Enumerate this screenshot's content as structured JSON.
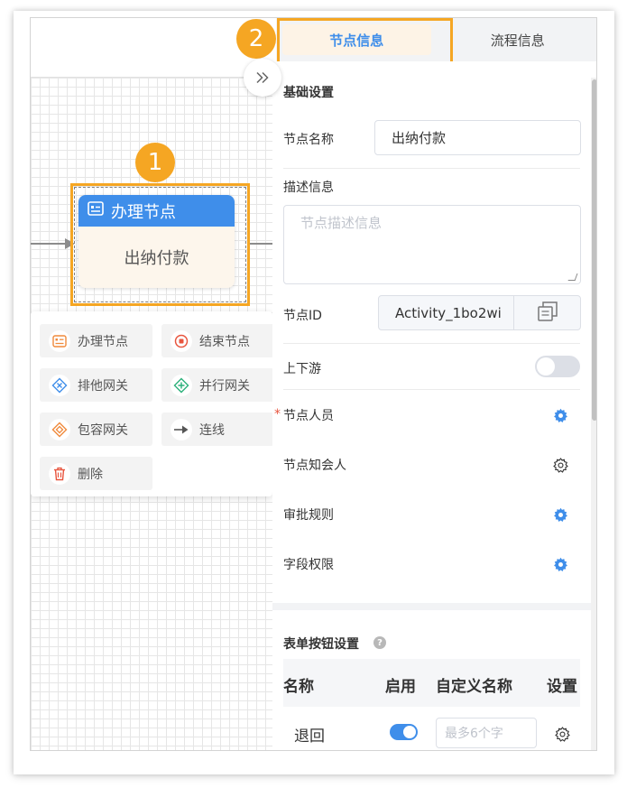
{
  "tabs": {
    "node_info": "节点信息",
    "process_info": "流程信息"
  },
  "badges": {
    "one": "1",
    "two": "2"
  },
  "node": {
    "type_label": "办理节点",
    "name": "出纳付款"
  },
  "context_menu": {
    "items": [
      {
        "label": "办理节点",
        "icon": "task-node-icon"
      },
      {
        "label": "结束节点",
        "icon": "end-node-icon"
      },
      {
        "label": "排他网关",
        "icon": "exclusive-gateway-icon"
      },
      {
        "label": "并行网关",
        "icon": "parallel-gateway-icon"
      },
      {
        "label": "包容网关",
        "icon": "inclusive-gateway-icon"
      },
      {
        "label": "连线",
        "icon": "connector-icon"
      },
      {
        "label": "删除",
        "icon": "trash-icon"
      }
    ]
  },
  "basic": {
    "title": "基础设置",
    "node_name_label": "节点名称",
    "node_name_value": "出纳付款",
    "desc_label": "描述信息",
    "desc_placeholder": "节点描述信息",
    "node_id_label": "节点ID",
    "node_id_value": "Activity_1bo2wi",
    "upstream_label": "上下游",
    "upstream_on": false,
    "required_mark": "*",
    "personnel_label": "节点人员",
    "cc_label": "节点知会人",
    "approval_label": "审批规则",
    "field_perm_label": "字段权限"
  },
  "form_buttons": {
    "title": "表单按钮设置",
    "help": "?",
    "columns": [
      "名称",
      "启用",
      "自定义名称",
      "设置"
    ],
    "rows": [
      {
        "name": "退回",
        "enabled": true,
        "custom_placeholder": "最多6个字"
      }
    ]
  },
  "colors": {
    "primary": "#3f8eea",
    "highlight": "#f5a623"
  }
}
